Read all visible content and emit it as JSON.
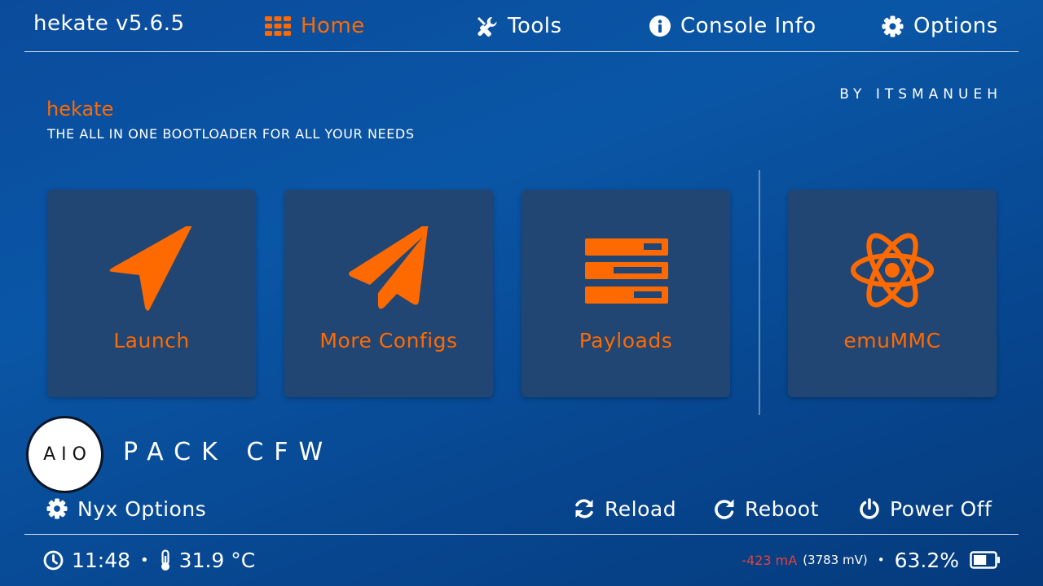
{
  "header": {
    "title": "hekate v5.6.5",
    "tabs": [
      {
        "label": "Home",
        "icon": "grid-icon",
        "active": true
      },
      {
        "label": "Tools",
        "icon": "tools-icon"
      },
      {
        "label": "Console Info",
        "icon": "info-icon"
      },
      {
        "label": "Options",
        "icon": "gear-icon"
      }
    ]
  },
  "intro": {
    "by_line": "BY ITSMANUEH",
    "app_name": "hekate",
    "tagline": "THE ALL IN ONE BOOTLOADER FOR ALL YOUR NEEDS"
  },
  "tiles": [
    {
      "label": "Launch",
      "icon": "navigation-arrow-icon"
    },
    {
      "label": "More Configs",
      "icon": "paper-plane-icon"
    },
    {
      "label": "Payloads",
      "icon": "server-stack-icon"
    },
    {
      "label": "emuMMC",
      "icon": "atom-icon"
    }
  ],
  "logo": {
    "circle_text": "AIO",
    "title": "PACK CFW"
  },
  "actions": {
    "nyx_options": "Nyx Options",
    "reload": "Reload",
    "reboot": "Reboot",
    "power_off": "Power Off"
  },
  "status": {
    "time": "11:48",
    "temperature": "31.9 °C",
    "current": "-423 mA",
    "voltage": "(3783 mV)",
    "separator": "•",
    "battery_percent": "63.2%",
    "battery_level": 0.632
  },
  "colors": {
    "accent": "#ff6a00",
    "tile_bg": "#214673",
    "current_negative": "#e8403a"
  }
}
